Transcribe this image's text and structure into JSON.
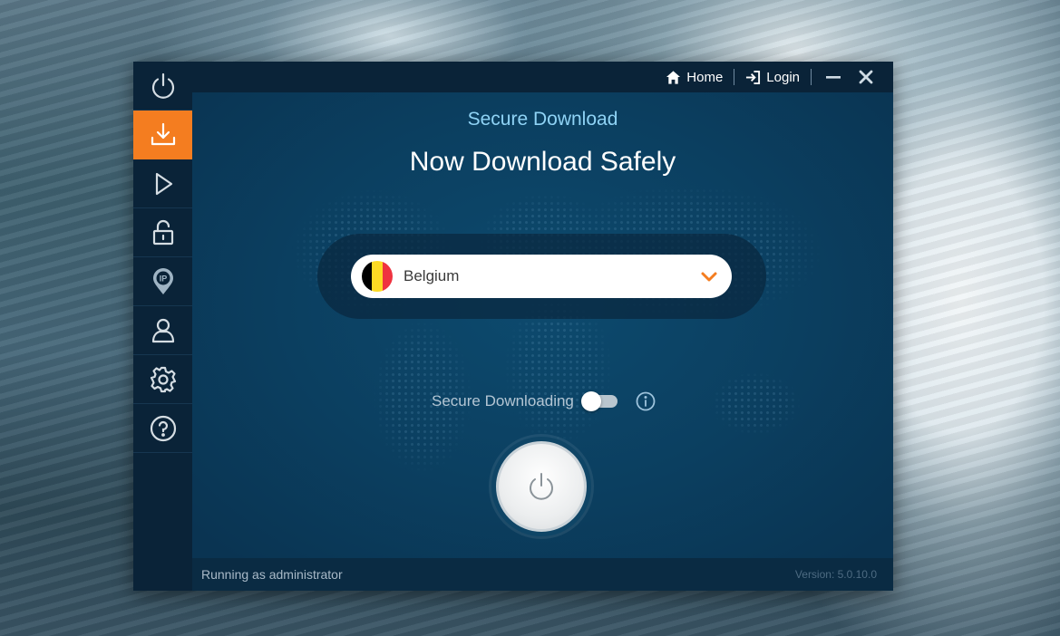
{
  "titlebar": {
    "home_label": "Home",
    "login_label": "Login"
  },
  "sidebar": {
    "items": [
      {
        "icon": "power-icon",
        "active": false
      },
      {
        "icon": "download-icon",
        "active": true
      },
      {
        "icon": "play-icon",
        "active": false
      },
      {
        "icon": "unlock-icon",
        "active": false
      },
      {
        "icon": "ip-location-icon",
        "active": false
      },
      {
        "icon": "user-icon",
        "active": false
      },
      {
        "icon": "gear-icon",
        "active": false
      },
      {
        "icon": "help-icon",
        "active": false
      }
    ]
  },
  "main": {
    "subtitle": "Secure Download",
    "headline": "Now Download Safely",
    "country": {
      "selected": "Belgium",
      "flag_colors": [
        "#000000",
        "#fdda24",
        "#ef3340"
      ]
    },
    "toggle": {
      "label": "Secure Downloading",
      "on": false
    }
  },
  "status": {
    "left": "Running as administrator",
    "version": "Version:  5.0.10.0"
  },
  "colors": {
    "accent": "#f47d20",
    "sidebar_bg": "#0a2338",
    "main_bg": "#0b3d5b",
    "subtitle": "#8fd3f5"
  }
}
